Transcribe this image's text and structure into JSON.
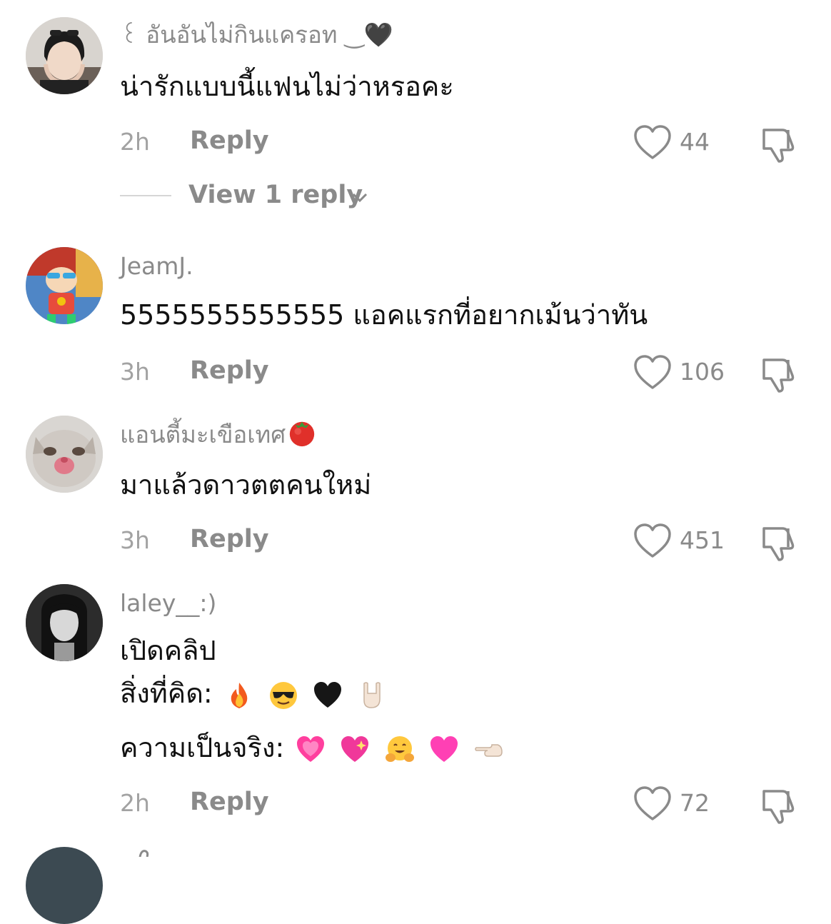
{
  "comments": [
    {
      "username": "꒰ อันอันไม่กินแครอท ‿🖤",
      "text_lines": [
        "น่ารักแบบนี้แฟนไม่ว่าหรอคะ"
      ],
      "time": "2h",
      "reply_label": "Reply",
      "likes": "44",
      "view_replies": "View 1 reply",
      "avatar": "girl-portrait-avatar"
    },
    {
      "username": "JeamJ.",
      "text_lines": [
        "5555555555555 แอคแรกที่อยากเม้นว่าทัน"
      ],
      "time": "3h",
      "reply_label": "Reply",
      "likes": "106",
      "avatar": "cartoon-avatar"
    },
    {
      "username": "แอนตี้มะเขือเทศ",
      "username_emoji": "tomato",
      "text_lines": [
        "มาแล้วดาวตตคนใหม่"
      ],
      "time": "3h",
      "reply_label": "Reply",
      "likes": "451",
      "avatar": "cat-avatar"
    },
    {
      "username": "laley__:)",
      "text_lines": [
        "เปิดคลิป",
        "สิ่งที่คิด:",
        "ความเป็นจริง:"
      ],
      "line2_emojis": [
        "fire",
        "sunglasses-face",
        "black-heart",
        "rock-hand"
      ],
      "line3_emojis": [
        "growing-heart",
        "sparkling-heart",
        "hugging-face",
        "pink-heart",
        "pointing-left-hand"
      ],
      "time": "2h",
      "reply_label": "Reply",
      "likes": "72",
      "avatar": "bw-portrait-avatar"
    }
  ],
  "colors": {
    "text": "#111111",
    "meta": "#8a8a8a",
    "time": "#a2a2a2",
    "background": "#ffffff"
  }
}
